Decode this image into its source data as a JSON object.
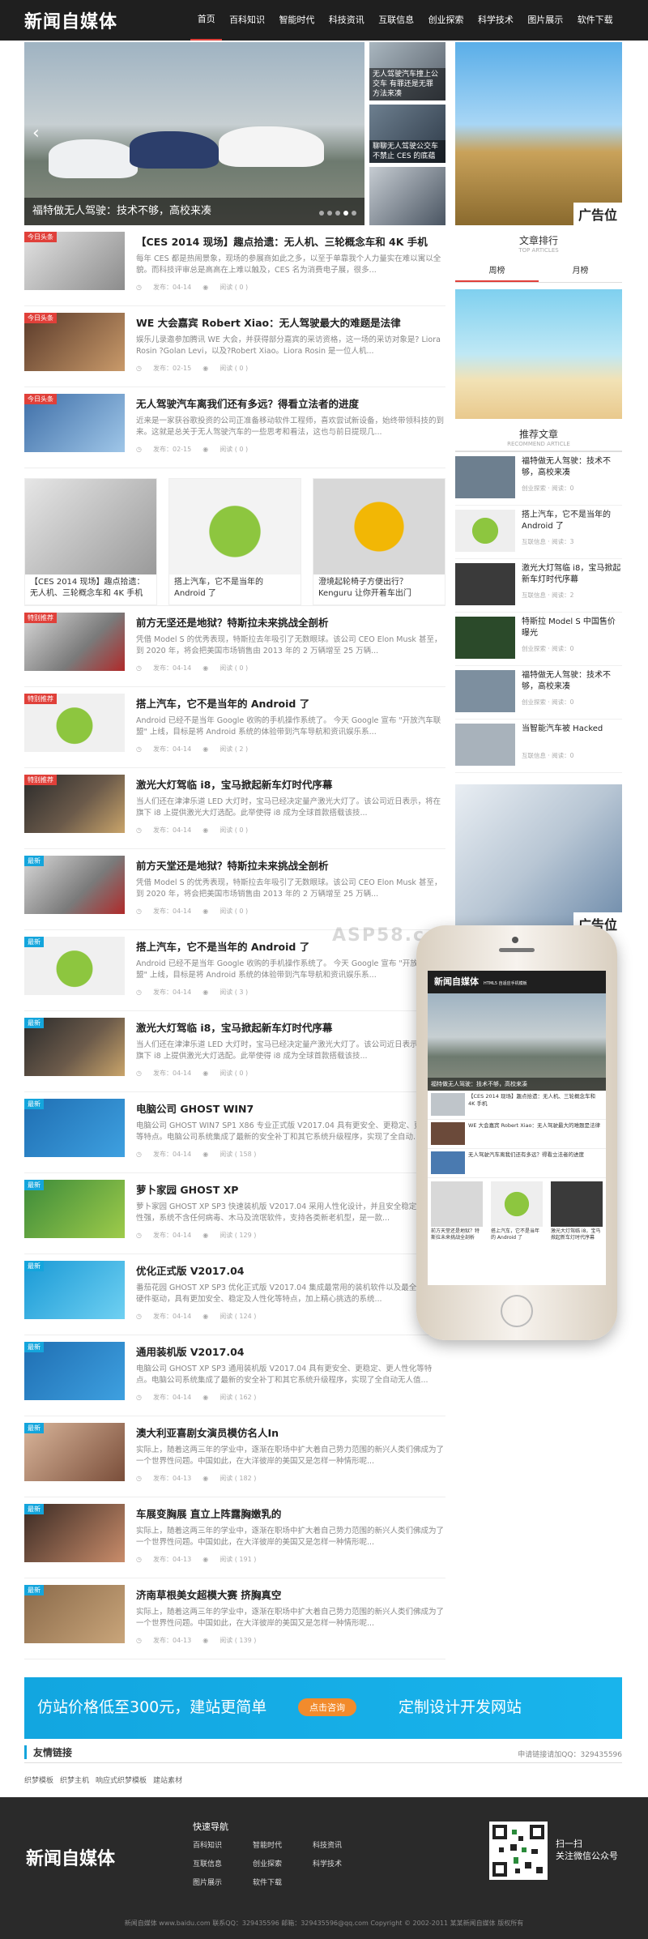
{
  "header": {
    "logo": "新闻自媒体",
    "nav": [
      "首页",
      "百科知识",
      "智能时代",
      "科技资讯",
      "互联信息",
      "创业探索",
      "科学技术",
      "图片展示",
      "软件下载"
    ]
  },
  "slider": {
    "caption": "福特做无人驾驶：技术不够，高校来凑",
    "thumbs": [
      "无人驾驶汽车撞上公交车 有罪还是无罪 方法来凑",
      "聊聊无人驾驶公交车不禁止 CES 的底蕴"
    ]
  },
  "articles_top": [
    {
      "tag": "今日头条",
      "title": "【CES 2014 现场】趣点拾遗：无人机、三轮概念车和 4K 手机",
      "desc": "每年 CES 都是热闹景象，现场的参展商如此之多，以至于单靠我个人力量实在难以寓以全貌。而科技评审总是高高在上难以触及，CES 名为消费电子展，很多...",
      "date": "发布：04-14",
      "views": "阅读 ( 0 )"
    },
    {
      "tag": "今日头条",
      "title": "WE 大会嘉宾 Robert Xiao：无人驾驶最大的难题是法律",
      "desc": "娱乐儿录邀参加腾讯 WE 大会，并获得部分嘉宾的采访资格，这一场的采访对象是? Liora Rosin ?Golan Levi，以及?Robert Xiao。Liora Rosin 是一位人机...",
      "date": "发布：02-15",
      "views": "阅读 ( 0 )"
    },
    {
      "tag": "今日头条",
      "title": "无人驾驶汽车离我们还有多远？得看立法者的进度",
      "desc": "近来是一家获谷歌投资的公司正准备移动软件工程师，喜欢尝试新设备，始终带领科技的到来。这就是总关于无人驾驶汽车的一些思考和看法，这也与前日提现几...",
      "date": "发布：02-15",
      "views": "阅读 ( 0 )"
    }
  ],
  "gallery": [
    "【CES 2014 现场】趣点拾遗：无人机、三轮概念车和 4K 手机",
    "搭上汽车，它不是当年的 Android 了",
    "澄境起轮椅子方便出行？Kenguru 让你开着车出门"
  ],
  "articles": [
    {
      "tag": "特别推荐",
      "title": "前方无坚还是地狱？特斯拉未来挑战全剖析",
      "desc": "凭借 Model S 的优秀表现，特斯拉去年吸引了无数眼球。该公司 CEO Elon Musk 甚至，到 2020 年，将会把美国市场销售由 2013 年的 2 万辆增至 25 万辆...",
      "date": "发布：04-14",
      "views": "阅读 ( 0 )",
      "cls": "s1"
    },
    {
      "tag": "特别推荐",
      "title": "搭上汽车，它不是当年的 Android 了",
      "desc": "Android 已经不是当年 Google 收购的手机操作系统了。 今天 Google 宣布 \"开放汽车联盟\" 上线，目标是将 Android 系统的体验带到汽车导航和资讯娱乐系...",
      "date": "发布：04-14",
      "views": "阅读 ( 2 )",
      "cls": "s2"
    },
    {
      "tag": "特别推荐",
      "title": "激光大灯驾临 i8，宝马掀起新车灯时代序幕",
      "desc": "当人们还在津津乐道 LED 大灯时，宝马已经决定量产激光大灯了。该公司近日表示，将在旗下 i8 上提供激光大灯选配。此举使得 i8 成为全球首款搭载该技...",
      "date": "发布：04-14",
      "views": "阅读 ( 0 )",
      "cls": "s3"
    },
    {
      "tag": "最新",
      "title": "前方天堂还是地狱？特斯拉未来挑战全剖析",
      "desc": "凭借 Model S 的优秀表现，特斯拉去年吸引了无数眼球。该公司 CEO Elon Musk 甚至，到 2020 年，将会把美国市场销售由 2013 年的 2 万辆增至 25 万辆...",
      "date": "发布：04-14",
      "views": "阅读 ( 0 )",
      "cls": "s1"
    },
    {
      "tag": "最新",
      "title": "搭上汽车，它不是当年的 Android 了",
      "desc": "Android 已经不是当年 Google 收购的手机操作系统了。 今天 Google 宣布 \"开放汽车联盟\" 上线，目标是将 Android 系统的体验带到汽车导航和资讯娱乐系...",
      "date": "发布：04-14",
      "views": "阅读 ( 3 )",
      "cls": "s2"
    },
    {
      "tag": "最新",
      "title": "激光大灯驾临 i8，宝马掀起新车灯时代序幕",
      "desc": "当人们还在津津乐道 LED 大灯时，宝马已经决定量产激光大灯了。该公司近日表示，将在旗下 i8 上提供激光大灯选配。此举使得 i8 成为全球首款搭载该技...",
      "date": "发布：04-14",
      "views": "阅读 ( 0 )",
      "cls": "s3"
    },
    {
      "tag": "最新",
      "title": "电脑公司 GHOST WIN7",
      "desc": "电脑公司 GHOST WIN7 SP1 X86 专业正式版 V2017.04 具有更安全、更稳定、更人性化等特点。电脑公司系统集成了最新的安全补丁和其它系统升级程序，实现了全自动...",
      "date": "发布：04-14",
      "views": "阅读 ( 158 )",
      "cls": "s4"
    },
    {
      "tag": "最新",
      "title": "萝卜家园 GHOST XP",
      "desc": "萝卜家园 GHOST XP SP3 快速装机版 V2017.04 采用人性化设计，并且安全稳定，实用性强，系统不含任何病毒、木马及流氓软件，支持各类新老机型，是一款...",
      "date": "发布：04-14",
      "views": "阅读 ( 129 )",
      "cls": "s5"
    },
    {
      "tag": "最新",
      "title": "优化正式版 V2017.04",
      "desc": "番茄花园 GHOST XP SP3 优化正式版 V2017.04 集成最常用的装机软件以及最全的万能硬件驱动，具有更加安全、稳定及人性化等特点，加上精心挑选的系统...",
      "date": "发布：04-14",
      "views": "阅读 ( 124 )",
      "cls": "s6"
    },
    {
      "tag": "最新",
      "title": "通用装机版 V2017.04",
      "desc": "电脑公司 GHOST XP SP3 通用装机版 V2017.04 具有更安全、更稳定、更人性化等特点。电脑公司系统集成了最新的安全补丁和其它系统升级程序，实现了全自动无人值...",
      "date": "发布：04-14",
      "views": "阅读 ( 162 )",
      "cls": "s4"
    },
    {
      "tag": "最新",
      "title": "澳大利亚喜剧女演员模仿名人In",
      "desc": "实际上，随着这两三年的学业中，逐渐在职场中扩大着自己势力范围的新兴人类们佛成为了一个世界性问题。中国如此，在大洋彼岸的美国又是怎样一种情形呢...",
      "date": "发布：04-13",
      "views": "阅读 ( 182 )",
      "cls": "s7"
    },
    {
      "tag": "最新",
      "title": "车展变胸展 直立上阵露胸嫩乳的",
      "desc": "实际上，随着这两三年的学业中，逐渐在职场中扩大着自己势力范围的新兴人类们佛成为了一个世界性问题。中国如此，在大洋彼岸的美国又是怎样一种情形呢...",
      "date": "发布：04-13",
      "views": "阅读 ( 191 )",
      "cls": "s8"
    },
    {
      "tag": "最新",
      "title": "济南草根美女超模大赛 挤胸真空",
      "desc": "实际上，随着这两三年的学业中，逐渐在职场中扩大着自己势力范围的新兴人类们佛成为了一个世界性问题。中国如此，在大洋彼岸的美国又是怎样一种情形呢...",
      "date": "发布：04-13",
      "views": "阅读 ( 139 )",
      "cls": "s9"
    }
  ],
  "sidebar": {
    "ad_label": "广告位",
    "rank_title": "文章排行",
    "rank_en": "TOP ARTICLES",
    "tabs": [
      "周榜",
      "月榜"
    ],
    "rec_title": "推荐文章",
    "rec_en": "RECOMMEND ARTICLE",
    "rec": [
      {
        "t": "福特做无人驾驶：技术不够，高校来凑",
        "m": "创业探索 · 阅读：0"
      },
      {
        "t": "搭上汽车，它不是当年的 Android 了",
        "m": "互联信息 · 阅读：3"
      },
      {
        "t": "激光大灯驾临 i8，宝马掀起新车灯时代序幕",
        "m": "互联信息 · 阅读：2"
      },
      {
        "t": "特斯拉 Model S 中国售价曝光",
        "m": "创业探索 · 阅读：0"
      },
      {
        "t": "福特做无人驾驶：技术不够，高校来凑",
        "m": "创业探索 · 阅读：0"
      },
      {
        "t": "当智能汽车被 Hacked",
        "m": "互联信息 · 阅读：0"
      }
    ],
    "ad2_label": "广告位"
  },
  "phone": {
    "logo": "新闻自媒体",
    "sub": "HTML5 自适应手机模板",
    "caption": "福特做无人驾驶：技术不够，高校来凑",
    "items": [
      "【CES 2014 现场】趣点拾遗：无人机、三轮概念车和 4K 手机",
      "WE 大会嘉宾 Robert Xiao：无人驾驶最大的难题是法律",
      "无人驾驶汽车离我们还有多远？得看立法者的进度"
    ],
    "gal": [
      "前方天堂还是地狱？特斯拉未来挑战全剖析",
      "搭上汽车，它不是当年的 Android 了",
      "激光大灯驾临 i8，宝马掀起新车灯时代序幕"
    ]
  },
  "watermark": "ASP58.com",
  "banner": {
    "left": "仿站价格低至300元，建站更简单",
    "button": "点击咨询",
    "right": "定制设计开发网站"
  },
  "friends": {
    "label": "友情链接",
    "qq": "申请链接请加QQ：329435596",
    "links": [
      "织梦模板",
      "织梦主机",
      "响应式织梦模板",
      "建站素材"
    ]
  },
  "footer": {
    "logo": "新闻自媒体",
    "quick_title": "快速导航",
    "quick": [
      "百科知识",
      "智能时代",
      "科技资讯",
      "互联信息",
      "创业探索",
      "科学技术",
      "图片展示",
      "软件下载"
    ],
    "qr_text": [
      "扫一扫",
      "关注微信公众号"
    ],
    "copyright": "新闻自媒体 www.baidu.com 联系QQ：329435596 邮箱：329435596@qq.com Copyright © 2002-2011 某某新闻自媒体 版权所有"
  }
}
